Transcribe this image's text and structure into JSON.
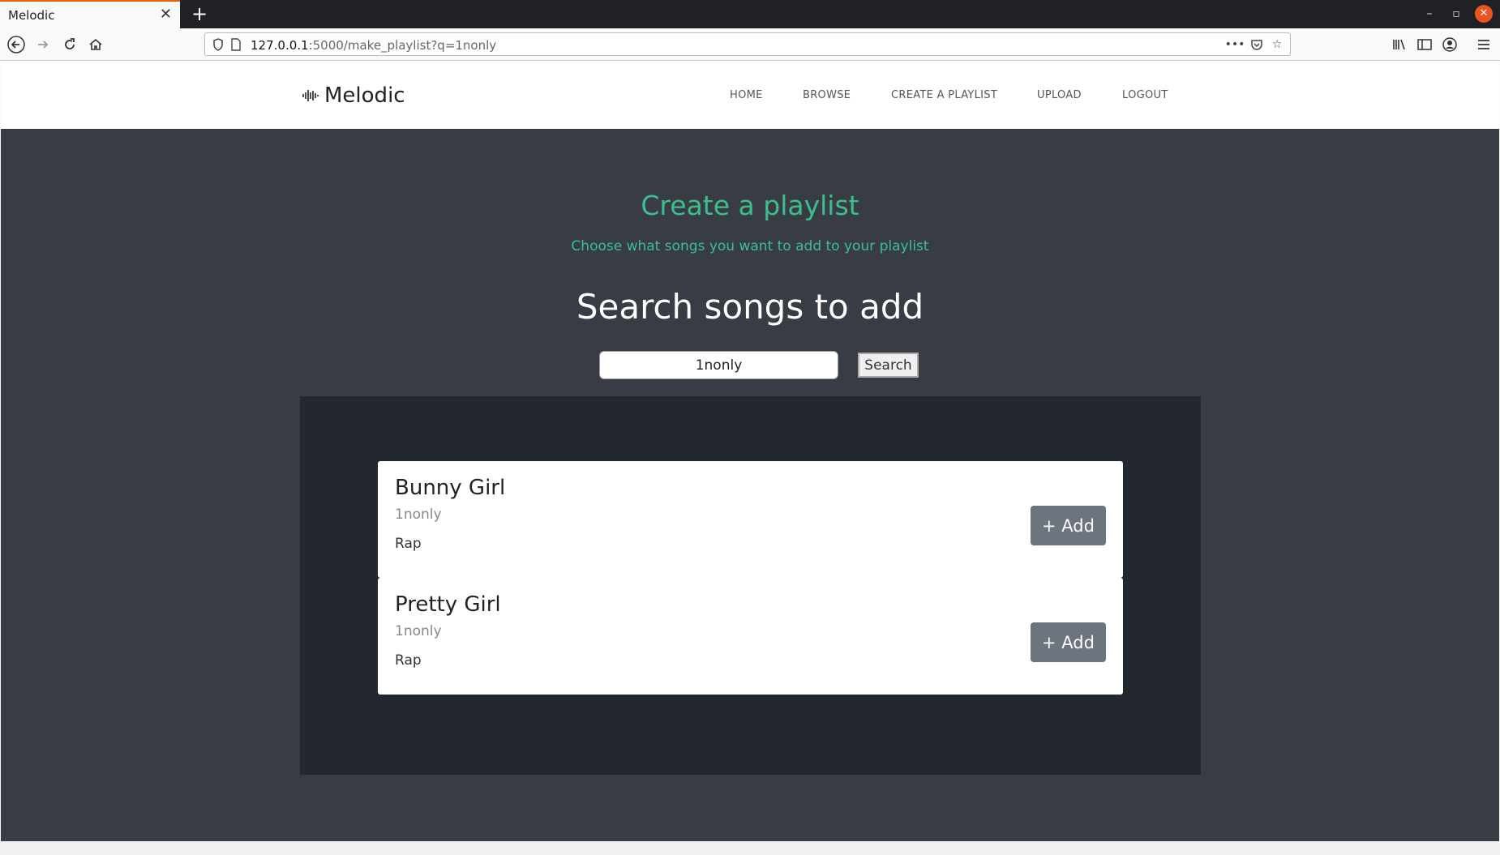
{
  "browser": {
    "tab_title": "Melodic",
    "url_host": "127.0.0.1",
    "url_rest": ":5000/make_playlist?q=1nonly"
  },
  "site": {
    "logo_text": "Melodic",
    "nav": [
      {
        "label": "HOME"
      },
      {
        "label": "BROWSE"
      },
      {
        "label": "CREATE A PLAYLIST"
      },
      {
        "label": "UPLOAD"
      },
      {
        "label": "LOGOUT"
      }
    ]
  },
  "page": {
    "title": "Create a playlist",
    "subtitle": "Choose what songs you want to add to your playlist",
    "search_title": "Search songs to add",
    "search_value": "1nonly",
    "search_button": "Search"
  },
  "results": [
    {
      "title": "Bunny Girl",
      "artist": "1nonly",
      "genre": "Rap",
      "add_label": "+ Add"
    },
    {
      "title": "Pretty Girl",
      "artist": "1nonly",
      "genre": "Rap",
      "add_label": "+ Add"
    }
  ],
  "colors": {
    "accent": "#3ebe8e",
    "main_bg": "#373c45",
    "results_bg": "#23272f",
    "button_bg": "#6c757d"
  }
}
